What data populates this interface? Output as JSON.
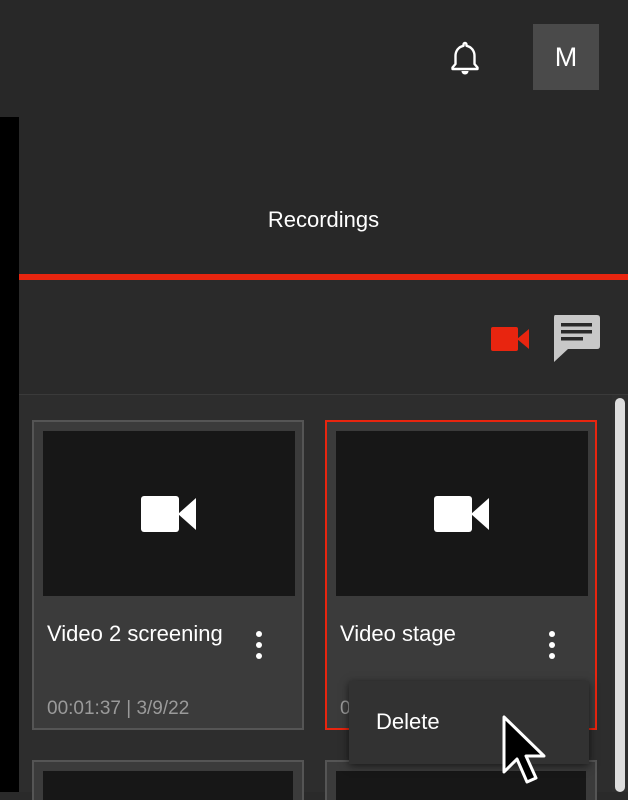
{
  "topbar": {
    "bell_icon": "bell-icon",
    "avatar_initial": "M"
  },
  "header": {
    "title": "Recordings"
  },
  "toolbar": {
    "video_filter_icon": "video-camera-icon",
    "chat_filter_icon": "chat-icon",
    "active_color": "#e8250f"
  },
  "recordings": [
    {
      "title": "Video 2 screening",
      "meta": "00:01:37 | 3/9/22",
      "selected": false
    },
    {
      "title": "Video stage",
      "meta": "0",
      "selected": true
    }
  ],
  "context_menu": {
    "items": [
      {
        "label": "Delete"
      }
    ]
  }
}
